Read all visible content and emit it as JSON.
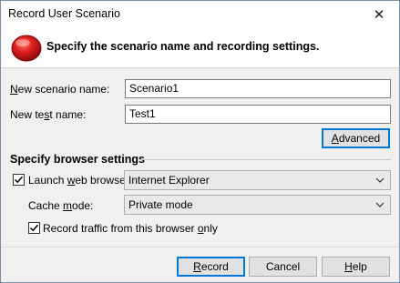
{
  "window": {
    "title": "Record User Scenario",
    "close_glyph": "✕"
  },
  "header": {
    "icon": "record-icon",
    "text": "Specify the scenario name and recording settings."
  },
  "form": {
    "scenario_name_label_pre": "",
    "scenario_name_label_key": "N",
    "scenario_name_label_post": "ew scenario name:",
    "scenario_name_value": "Scenario1",
    "test_name_label_pre": "New te",
    "test_name_label_key": "s",
    "test_name_label_post": "t name:",
    "test_name_value": "Test1",
    "advanced_pre": "",
    "advanced_key": "A",
    "advanced_post": "dvanced"
  },
  "browser": {
    "section_title": "Specify browser settings",
    "launch_pre": "Launch ",
    "launch_key": "w",
    "launch_post": "eb browser:",
    "launch_checked": true,
    "browser_value": "Internet Explorer",
    "cache_pre": "Cache ",
    "cache_key": "m",
    "cache_post": "ode:",
    "cache_value": "Private mode",
    "record_pre": "Record traffic from this browser ",
    "record_key": "o",
    "record_post": "nly",
    "record_checked": true
  },
  "buttons": {
    "record_pre": "",
    "record_key": "R",
    "record_post": "ecord",
    "cancel": "Cancel",
    "help_pre": "",
    "help_key": "H",
    "help_post": "elp"
  },
  "colors": {
    "accent": "#0078d7",
    "icon_red": "#d81c1c"
  }
}
